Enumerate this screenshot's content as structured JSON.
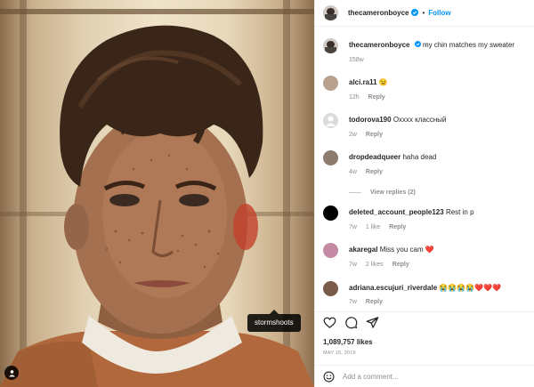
{
  "header": {
    "username": "thecameronboyce",
    "separator": "•",
    "follow_label": "Follow"
  },
  "photo": {
    "tag_label": "stormshoots"
  },
  "caption": {
    "username": "thecameronboyce",
    "text": "my chin matches my sweater",
    "age": "158w"
  },
  "comments": [
    {
      "username": "alci.ra11",
      "text": "😉",
      "age": "12h",
      "likes": "",
      "reply": "Reply",
      "avatar_color": "#b9a18f"
    },
    {
      "username": "todorova190",
      "text": "Охххх классный",
      "age": "2w",
      "likes": "",
      "reply": "Reply",
      "avatar_color": "#dbdbdb"
    },
    {
      "username": "dropdeadqueer",
      "text": "haha dead",
      "age": "4w",
      "likes": "",
      "reply": "Reply",
      "avatar_color": "#8c7b6e"
    },
    {
      "username": "deleted_account_people123",
      "text": "Rest in p",
      "age": "7w",
      "likes": "1 like",
      "reply": "Reply",
      "avatar_color": "#000000"
    },
    {
      "username": "akaregal",
      "text": "Miss you cam ❤️",
      "age": "7w",
      "likes": "2 likes",
      "reply": "Reply",
      "avatar_color": "#c48aa3"
    },
    {
      "username": "adriana.escujuri_riverdale",
      "text": "😭😭😭😭❤️❤️❤️",
      "age": "7w",
      "likes": "",
      "reply": "Reply",
      "avatar_color": "#7a5a4a"
    }
  ],
  "view_replies": "View replies (2)",
  "actions": {
    "like_icon": "heart-icon",
    "comment_icon": "comment-icon",
    "share_icon": "share-icon"
  },
  "likes": "1,089,757 likes",
  "date": "MAY 15, 2019",
  "add_comment": {
    "placeholder": "Add a comment..."
  },
  "colors": {
    "accent": "#0095f6",
    "text": "#262626",
    "muted": "#8e8e8e"
  }
}
